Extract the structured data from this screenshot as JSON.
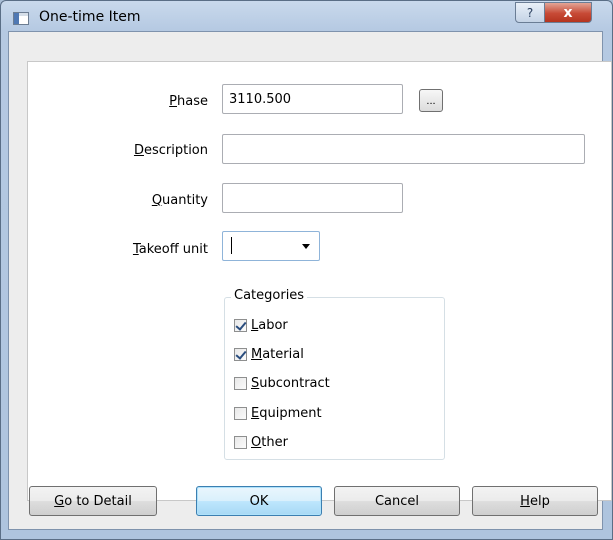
{
  "window": {
    "title": "One-time Item",
    "help_glyph": "?",
    "close_glyph": "x"
  },
  "form": {
    "phase": {
      "label_prefix": "",
      "label_mnemonic": "P",
      "label_rest": "hase",
      "value": "3110.500",
      "browse_label": "..."
    },
    "description": {
      "label_mnemonic": "D",
      "label_rest": "escription",
      "value": ""
    },
    "quantity": {
      "label_mnemonic": "Q",
      "label_rest": "uantity",
      "value": ""
    },
    "takeoff_unit": {
      "label_mnemonic": "T",
      "label_rest": "akeoff unit",
      "selected": ""
    }
  },
  "categories": {
    "legend": "Categories",
    "items": [
      {
        "mnemonic": "L",
        "rest": "abor",
        "checked": true
      },
      {
        "mnemonic": "M",
        "rest": "aterial",
        "checked": true
      },
      {
        "mnemonic": "S",
        "rest": "ubcontract",
        "checked": false
      },
      {
        "mnemonic": "E",
        "rest": "quipment",
        "checked": false
      },
      {
        "mnemonic": "O",
        "rest": "ther",
        "checked": false
      }
    ]
  },
  "buttons": {
    "go_to_detail": {
      "mnemonic": "G",
      "rest": "o to Detail"
    },
    "ok": "OK",
    "cancel": "Cancel",
    "help": {
      "mnemonic": "H",
      "rest": "elp"
    }
  }
}
